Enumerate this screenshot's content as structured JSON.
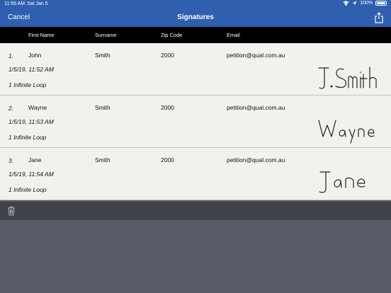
{
  "status_bar": {
    "time": "11:55 AM",
    "date": "Sat Jan 5",
    "battery": "100%"
  },
  "nav": {
    "cancel_label": "Cancel",
    "title": "Signatures"
  },
  "columns": {
    "first_name": "First Name",
    "surname": "Surname",
    "zip_code": "Zip Code",
    "email": "Email"
  },
  "rows": [
    {
      "num": "1.",
      "first": "John",
      "surname": "Smith",
      "zip": "2000",
      "email": "petition@qual.com.au",
      "datetime": "1/5/19, 11:52 AM",
      "address": "1 Infinite Loop",
      "signature": "J.Smith"
    },
    {
      "num": "2.",
      "first": "Wayne",
      "surname": "Smith",
      "zip": "2000",
      "email": "petition@qual.com.au",
      "datetime": "1/5/19, 11:53 AM",
      "address": "1 Infinite Loop",
      "signature": "Wayne"
    },
    {
      "num": "3.",
      "first": "Jane",
      "surname": "Smith",
      "zip": "2000",
      "email": "petition@qual.com.au",
      "datetime": "1/5/19, 11:54 AM",
      "address": "1 Infinite Loop",
      "signature": "Jane"
    }
  ],
  "icons": {
    "share": "share-icon",
    "trash": "trash-icon",
    "wifi": "wifi-icon",
    "location": "location-icon",
    "battery": "battery-icon"
  },
  "colors": {
    "nav_bg": "#2f5fae",
    "header_bg": "#000000",
    "row_bg": "#f1f1ed",
    "toolbar_bg": "#3f4247",
    "background": "#575c66"
  }
}
